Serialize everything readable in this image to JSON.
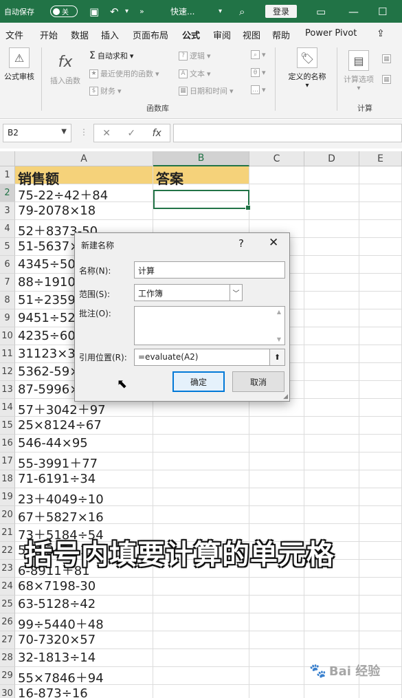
{
  "titlebar": {
    "autosave_label": "自动保存",
    "autosave_state": "关",
    "quick_access_more": "»",
    "doc_title": "快速...",
    "login_label": "登录"
  },
  "tabs": [
    "文件",
    "开始",
    "数据",
    "插入",
    "页面布局",
    "公式",
    "审阅",
    "视图",
    "帮助",
    "Power Pivot"
  ],
  "active_tab": "公式",
  "ribbon": {
    "formula_audit": "公式审核",
    "insert_function": "插入函数",
    "autosum": "自动求和",
    "recent": "最近使用的函数",
    "financial": "财务",
    "logical": "逻辑",
    "text": "文本",
    "datetime": "日期和时间",
    "define_name": "定义的名称",
    "calc_options": "计算选项",
    "group_function_library": "函数库",
    "group_calc": "计算"
  },
  "formula_bar": {
    "name_box": "B2",
    "formula": ""
  },
  "columns": [
    "A",
    "B",
    "C",
    "D",
    "E"
  ],
  "sheet": {
    "header_a": "销售额",
    "header_b": "答案",
    "rows": [
      "75-22÷42＋84",
      "79-2078×18",
      "52＋8373-50",
      "51-5637×11",
      "4345÷50×76",
      "88÷1910×60",
      "51÷2359×30",
      "9451÷52×66",
      "4235÷60×93",
      "31123×3-40",
      "5362-59×33",
      "87-5996×100",
      "57＋3042＋97",
      "25×8124÷67",
      "546-44×95",
      "55-3991＋77",
      "71-6191÷34",
      "23＋4049÷10",
      "67＋5827×16",
      "73＋5184÷54",
      "53-9342÷13",
      "6-8911＋81",
      "68×7198-30",
      "63-5128÷42",
      "99÷5440＋48",
      "70-7320×57",
      "32-1813÷14",
      "55×7846＋94",
      "16-873÷16"
    ]
  },
  "dialog": {
    "title": "新建名称",
    "help": "?",
    "close": "✕",
    "name_label": "名称(N):",
    "name_value": "计算",
    "scope_label": "范围(S):",
    "scope_value": "工作簿",
    "comment_label": "批注(O):",
    "ref_label": "引用位置(R):",
    "ref_value": "=evaluate(A2)",
    "ok_label": "确定",
    "cancel_label": "取消"
  },
  "caption": "括号内填要计算的单元格",
  "watermark": "Bai 经验"
}
